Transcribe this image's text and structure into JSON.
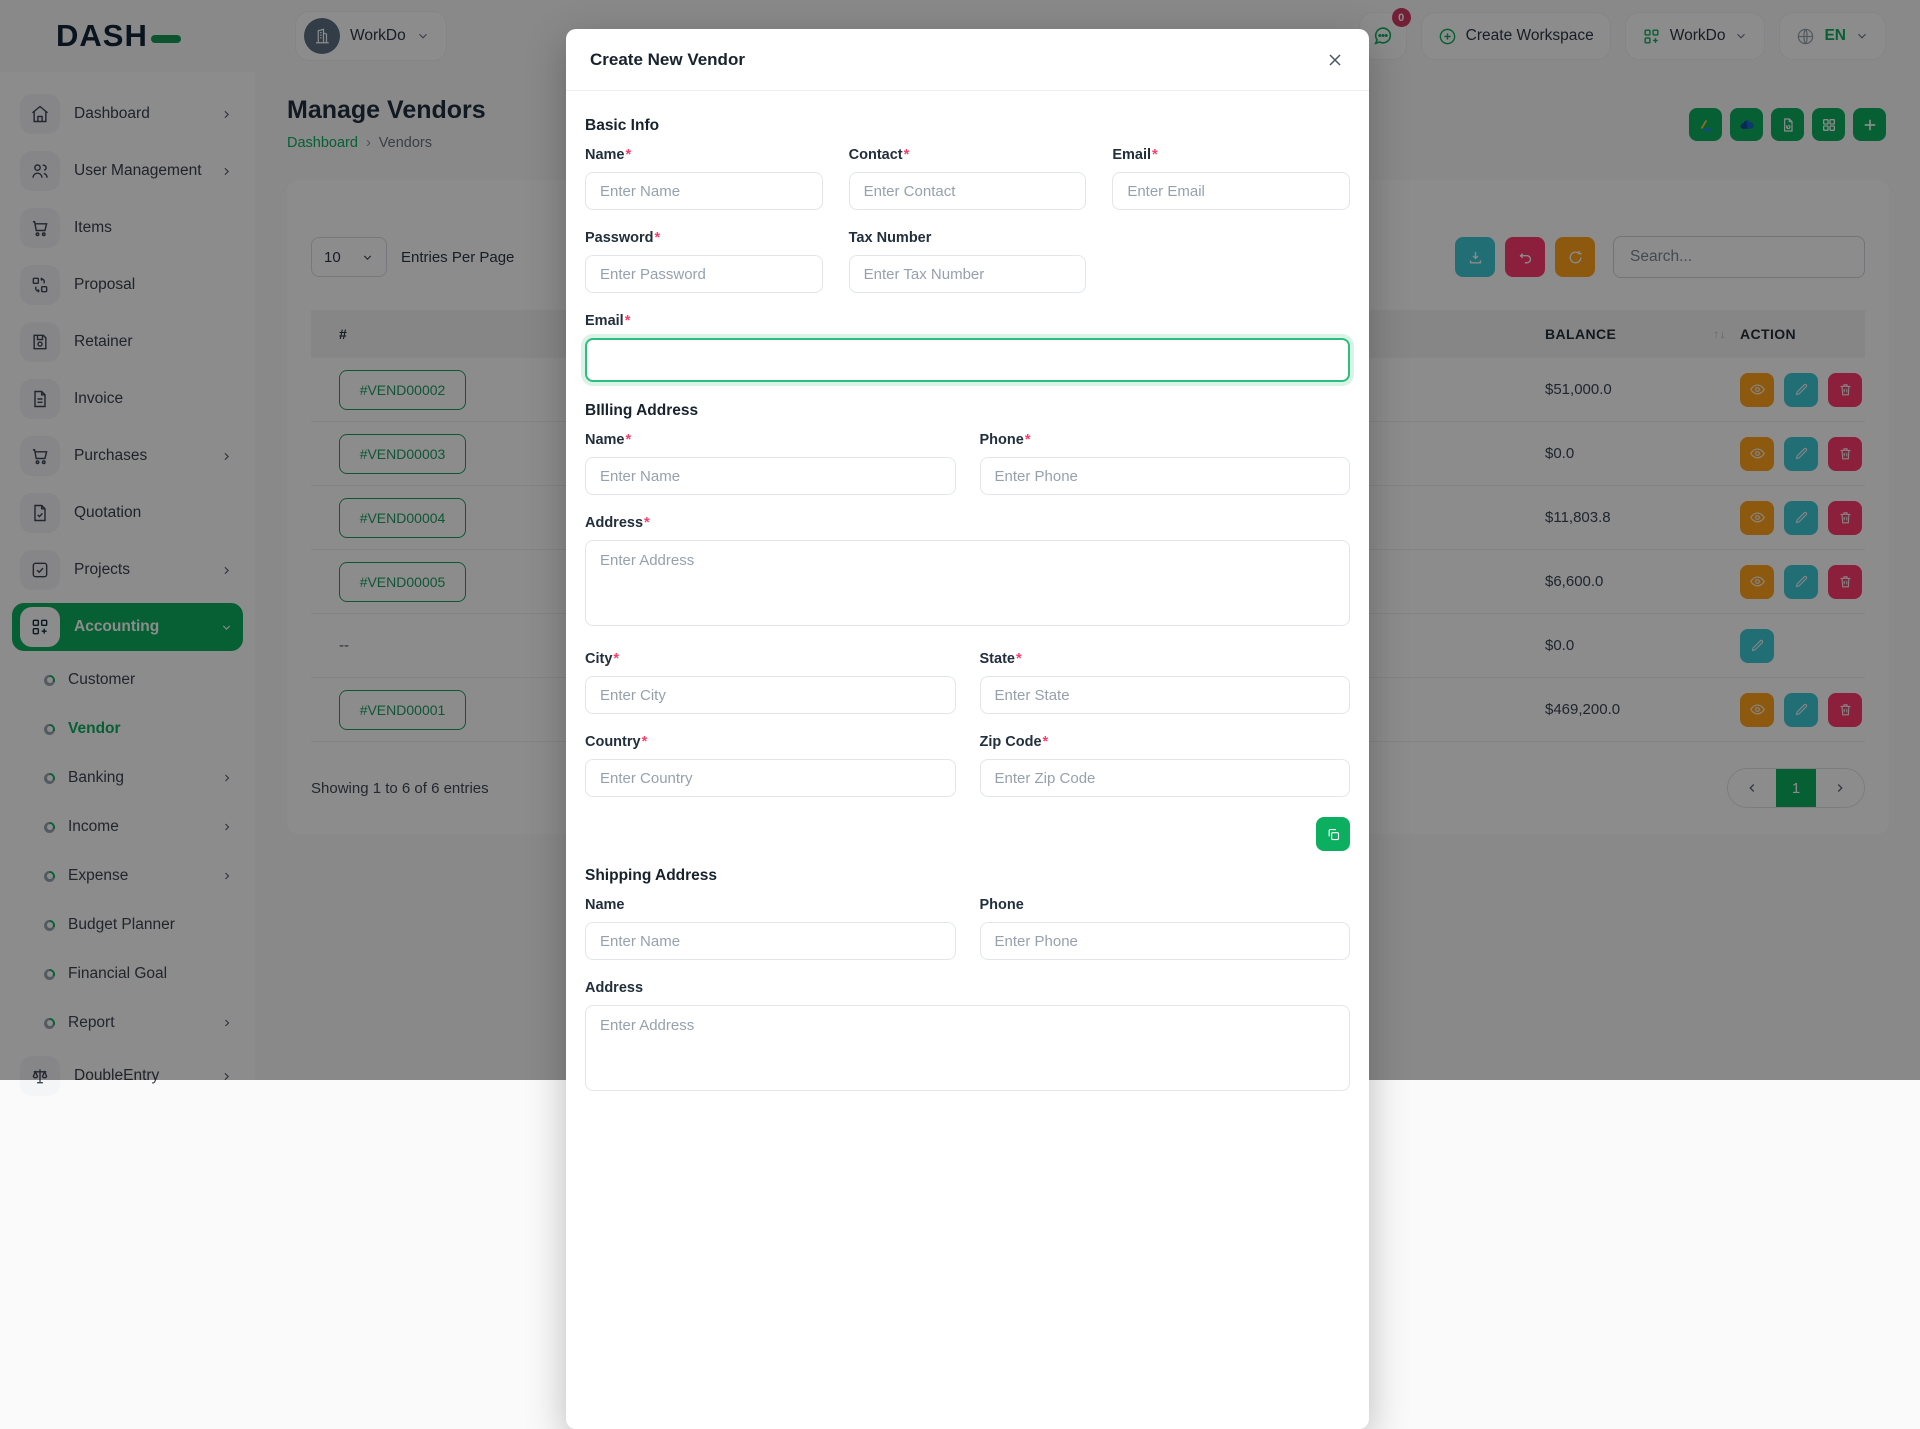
{
  "brand": {
    "name": "DASH"
  },
  "header": {
    "workspace_name": "WorkDo",
    "chat_badge": "0",
    "create_workspace_label": "Create Workspace",
    "app_menu_label": "WorkDo",
    "language_label": "EN"
  },
  "sidebar": {
    "items": [
      {
        "label": "Dashboard",
        "icon": "home-icon"
      },
      {
        "label": "User Management",
        "icon": "users-icon"
      },
      {
        "label": "Items",
        "icon": "cart-icon"
      },
      {
        "label": "Proposal",
        "icon": "swap-boxes-icon"
      },
      {
        "label": "Retainer",
        "icon": "floppy-icon"
      },
      {
        "label": "Invoice",
        "icon": "file-text-icon"
      },
      {
        "label": "Purchases",
        "icon": "cart-icon"
      },
      {
        "label": "Quotation",
        "icon": "file-check-icon"
      },
      {
        "label": "Projects",
        "icon": "check-square-icon"
      },
      {
        "label": "Accounting",
        "icon": "grid-plus-icon"
      }
    ],
    "accounting_sub": [
      {
        "label": "Customer"
      },
      {
        "label": "Vendor"
      },
      {
        "label": "Banking"
      },
      {
        "label": "Income"
      },
      {
        "label": "Expense"
      },
      {
        "label": "Budget Planner"
      },
      {
        "label": "Financial Goal"
      },
      {
        "label": "Report"
      }
    ],
    "double_entry_label": "DoubleEntry"
  },
  "page": {
    "title": "Manage Vendors",
    "breadcrumb_home": "Dashboard",
    "breadcrumb_separator": "›",
    "breadcrumb_current": "Vendors",
    "entries_per_page_value": "10",
    "entries_per_page_label": "Entries Per Page",
    "search_placeholder": "Search...",
    "table": {
      "col_id": "#",
      "col_balance": "BALANCE",
      "col_action": "ACTION",
      "sort_icon": "↑↓",
      "rows": [
        {
          "id": "#VEND00002",
          "balance": "$51,000.0"
        },
        {
          "id": "#VEND00003",
          "balance": "$0.0"
        },
        {
          "id": "#VEND00004",
          "balance": "$11,803.8"
        },
        {
          "id": "#VEND00005",
          "balance": "$6,600.0"
        },
        {
          "id": "--",
          "balance": "$0.0"
        },
        {
          "id": "#VEND00001",
          "balance": "$469,200.0"
        }
      ],
      "summary": "Showing 1 to 6 of 6 entries",
      "page_number": "1"
    }
  },
  "modal": {
    "title": "Create New Vendor",
    "required_marker": "*",
    "basic_info_heading": "Basic Info",
    "billing_heading": "BIlling Address",
    "shipping_heading": "Shipping Address",
    "fields": {
      "name_label": "Name",
      "contact_label": "Contact",
      "email_label": "Email",
      "password_label": "Password",
      "tax_label": "Tax Number",
      "phone_label": "Phone",
      "address_label": "Address",
      "city_label": "City",
      "state_label": "State",
      "country_label": "Country",
      "zip_label": "Zip Code",
      "name_ph": "Enter Name",
      "contact_ph": "Enter Contact",
      "email_ph": "Enter Email",
      "password_ph": "Enter Password",
      "tax_ph": "Enter Tax Number",
      "phone_ph": "Enter Phone",
      "address_ph": "Enter Address",
      "city_ph": "Enter City",
      "state_ph": "Enter State",
      "country_ph": "Enter Country",
      "zip_ph": "Enter Zip Code",
      "focused_email_value": ""
    }
  },
  "colors": {
    "primary": "#0CAF60",
    "warning": "#FFA21D",
    "info": "#3EC9D6",
    "danger": "#FF3A6E"
  },
  "icons": [
    "home-icon",
    "users-icon",
    "cart-icon",
    "swap-boxes-icon",
    "floppy-icon",
    "file-text-icon",
    "file-check-icon",
    "check-square-icon",
    "grid-plus-icon",
    "scales-icon",
    "chat-icon",
    "plus-circle-icon",
    "grid-icon",
    "globe-icon",
    "building-icon",
    "drive-icon",
    "onedrive-icon",
    "export-doc-icon",
    "plus-icon",
    "download-icon",
    "undo-icon",
    "refresh-icon",
    "eye-icon",
    "pencil-icon",
    "trash-icon",
    "copy-icon",
    "close-icon",
    "chevron-icons"
  ]
}
